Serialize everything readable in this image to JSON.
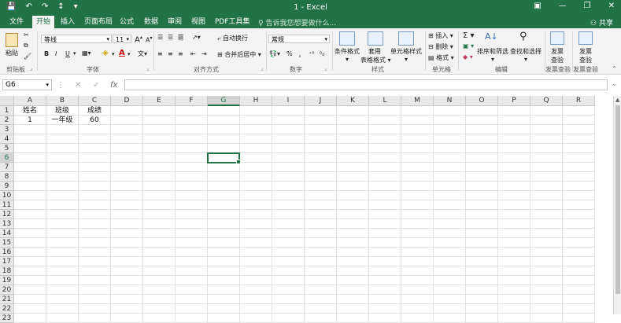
{
  "app": {
    "window_title": "1 - Excel",
    "qat": [
      "💾",
      "↶",
      "↷",
      "↕",
      "▾"
    ],
    "window_controls": [
      "▣",
      "—",
      "❐",
      "✕"
    ],
    "share": "共享"
  },
  "tabs": [
    "文件",
    "开始",
    "插入",
    "页面布局",
    "公式",
    "数据",
    "审阅",
    "视图",
    "PDF工具集"
  ],
  "active_tab": "开始",
  "tell_me": "告诉我您想要做什么...",
  "ribbon": {
    "clipboard": {
      "paste": "粘贴",
      "label": "剪贴板"
    },
    "font": {
      "name": "等线",
      "size": "11",
      "grow": "A",
      "shrink": "A",
      "bold": "B",
      "italic": "I",
      "underline": "U",
      "fontcolor": "A",
      "phonetic": "文",
      "label": "字体"
    },
    "alignment": {
      "wrap": "自动换行",
      "merge": "合并后居中",
      "label": "对齐方式"
    },
    "number": {
      "format": "常规",
      "percent": "%",
      "comma": "，",
      "label": "数字"
    },
    "styles": {
      "conditional": [
        "条件格式",
        "▾"
      ],
      "table": [
        "套用",
        "表格格式 ▾"
      ],
      "cellstyle": [
        "单元格样式",
        "▾"
      ],
      "label": "样式"
    },
    "cells": {
      "insert": "插入",
      "delete": "删除",
      "format": "格式",
      "label": "单元格"
    },
    "editing": {
      "sort": "排序和筛选",
      "find": "查找和选择",
      "label": "编辑"
    },
    "invoice": {
      "check1": [
        "发票",
        "查验"
      ],
      "check2": [
        "发票",
        "查验"
      ],
      "label1": "发票查验",
      "label2": "发票查验"
    }
  },
  "formula_bar": {
    "name_box": "G6",
    "cancel": "✕",
    "enter": "✓",
    "fx": "fx",
    "value": ""
  },
  "columns": [
    "A",
    "B",
    "C",
    "D",
    "E",
    "F",
    "G",
    "H",
    "I",
    "J",
    "K",
    "L",
    "M",
    "N",
    "O",
    "P",
    "Q",
    "R"
  ],
  "rows": [
    "1",
    "2",
    "3",
    "4",
    "5",
    "6",
    "7",
    "8",
    "9",
    "10",
    "11",
    "12",
    "13",
    "14",
    "15",
    "16",
    "17",
    "18",
    "19",
    "20",
    "21",
    "22",
    "23"
  ],
  "cells": [
    {
      "row": 0,
      "col": 0,
      "value": "姓名"
    },
    {
      "row": 0,
      "col": 1,
      "value": "班级"
    },
    {
      "row": 0,
      "col": 2,
      "value": "成绩"
    },
    {
      "row": 1,
      "col": 0,
      "value": "1"
    },
    {
      "row": 1,
      "col": 1,
      "value": "一年级"
    },
    {
      "row": 1,
      "col": 2,
      "value": "60"
    }
  ],
  "selected": {
    "row": 5,
    "col": 6
  },
  "colors": {
    "brand": "#217346"
  }
}
